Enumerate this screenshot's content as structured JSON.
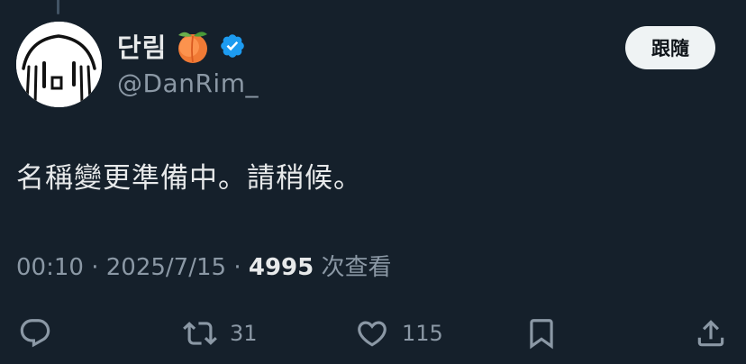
{
  "author": {
    "display_name": "단림",
    "handle": "@DanRim_",
    "verified": true
  },
  "follow_button": {
    "label": "跟隨"
  },
  "tweet": {
    "text": "名稱變更準備中。請稍候。"
  },
  "meta": {
    "time": "00:10",
    "separator": "·",
    "date": "2025/7/15",
    "views_count": "4995",
    "views_label": "次查看"
  },
  "actions": {
    "reply": {
      "icon": "reply-icon"
    },
    "retweet": {
      "icon": "retweet-icon",
      "count": "31"
    },
    "like": {
      "icon": "heart-icon",
      "count": "115"
    },
    "bookmark": {
      "icon": "bookmark-icon"
    },
    "share": {
      "icon": "share-icon"
    }
  },
  "colors": {
    "background": "#15202b",
    "text_primary": "#e7e9ea",
    "text_secondary": "#8b98a5",
    "verified_blue": "#1d9bf0",
    "follow_button_bg": "#eff3f4"
  }
}
